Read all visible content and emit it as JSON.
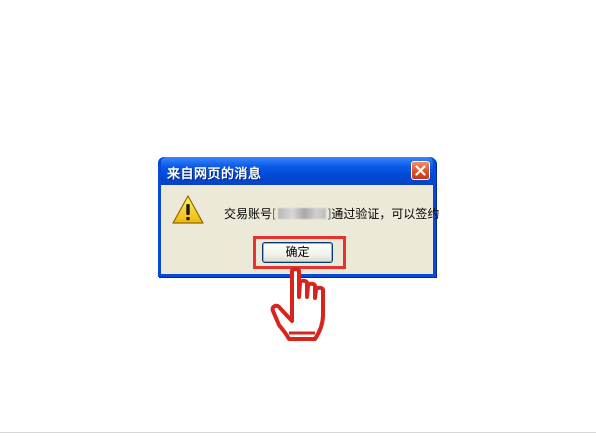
{
  "dialog": {
    "title": "来自网页的消息",
    "message_prefix": "交易账号",
    "message_masked": "",
    "message_suffix": "通过验证，可以签约",
    "ok_label": "确定"
  },
  "icons": {
    "warning": "warning-triangle-icon",
    "close": "close-x-icon",
    "pointer": "hand-pointer-cursor-icon"
  },
  "colors": {
    "title_bar": "#0a5ae6",
    "dialog_body": "#ece9d8",
    "highlight": "#e8322e",
    "close_button": "#d9532b"
  }
}
